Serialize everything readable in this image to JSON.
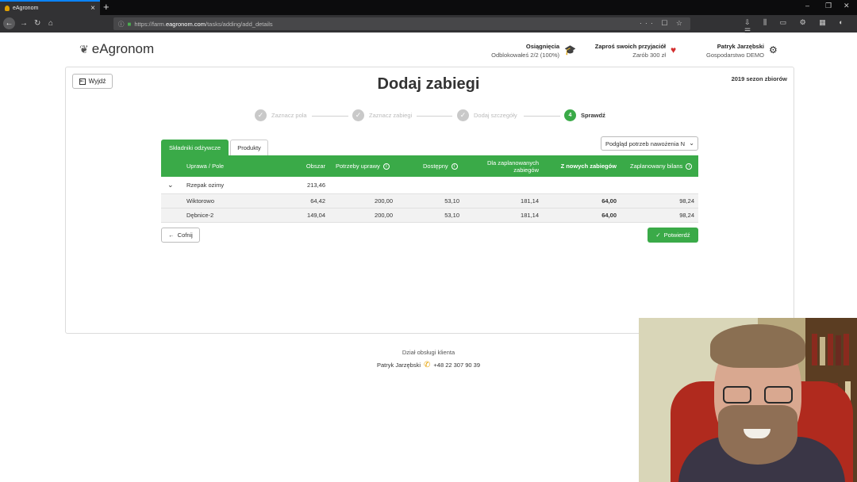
{
  "browser": {
    "tab_title": "eAgronom",
    "url_prefix": "https://farm.",
    "url_host": "eagronom.com",
    "url_path": "/tasks/adding/add_details"
  },
  "header": {
    "logo": "eAgronom",
    "achievements_title": "Osiągnięcia",
    "achievements_sub": "Odblokowałeś 2/2 (100%)",
    "invite_title": "Zaproś swoich przyjaciół",
    "invite_sub": "Zarób 300 zł",
    "user_name": "Patryk Jarzębski",
    "user_farm": "Gospodarstwo DEMO"
  },
  "page": {
    "exit_label": "Wyjdź",
    "title": "Dodaj zabiegi",
    "season": "2019 sezon zbiorów"
  },
  "stepper": [
    {
      "label": "Zaznacz pola",
      "mark": "✓"
    },
    {
      "label": "Zaznacz zabiegi",
      "mark": "✓"
    },
    {
      "label": "Dodaj szczegóły",
      "mark": "✓"
    },
    {
      "label": "Sprawdź",
      "mark": "4"
    }
  ],
  "tabs": {
    "nutrients": "Składniki odżywcze",
    "products": "Produkty"
  },
  "preview_select": "Podgląd potrzeb nawożenia N",
  "table": {
    "columns": {
      "crop": "Uprawa / Pole",
      "area": "Obszar",
      "needs": "Potrzeby uprawy",
      "available": "Dostępny",
      "planned_1": "Dla zaplanowanych",
      "planned_2": "zabiegów",
      "new": "Z nowych zabiegów",
      "balance": "Zaplanowany bilans"
    },
    "group": {
      "name": "Rzepak ozimy",
      "area": "213,46"
    },
    "rows": [
      {
        "name": "Wiktorowo",
        "area": "64,42",
        "needs": "200,00",
        "available": "53,10",
        "planned": "181,14",
        "new": "64,00",
        "balance": "98,24"
      },
      {
        "name": "Dębnice-2",
        "area": "149,04",
        "needs": "200,00",
        "available": "53,10",
        "planned": "181,14",
        "new": "64,00",
        "balance": "98,24"
      }
    ]
  },
  "buttons": {
    "back": "Cofnij",
    "confirm": "Potwierdź"
  },
  "footer": {
    "title": "Dział obsługi klienta",
    "contact_name": "Patryk Jarzębski",
    "phone": "+48 22 307 90 39"
  }
}
